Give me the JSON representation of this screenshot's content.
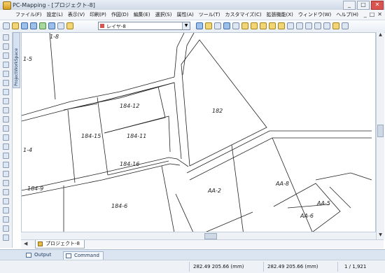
{
  "window": {
    "title": "PC-Mapping - [プロジェクト-8]",
    "minimize": "_",
    "maximize": "□",
    "close": "✕"
  },
  "menu": [
    "ファイル(F)",
    "設定(L)",
    "表示(V)",
    "印刷(P)",
    "作図(D)",
    "編集(E)",
    "選択(S)",
    "属性(A)",
    "ツール(T)",
    "カスタマイズ(C)",
    "拡張機能(X)",
    "ウィンドウ(W)",
    "ヘルプ(H)"
  ],
  "mdi_controls": [
    "_",
    "□",
    "✕"
  ],
  "toolbar": {
    "layer_combo": "レイヤ-8"
  },
  "side_panel": {
    "label": "ProjectWorkSpace"
  },
  "map": {
    "parcel_labels": [
      {
        "text": "1-4",
        "name": "label-1-4"
      },
      {
        "text": "184-12",
        "name": "label-184-12"
      },
      {
        "text": "184-15",
        "name": "label-184-15"
      },
      {
        "text": "184-11",
        "name": "label-184-11"
      },
      {
        "text": "184-16",
        "name": "label-184-16"
      },
      {
        "text": "184-6",
        "name": "label-184-6"
      },
      {
        "text": "184-9",
        "name": "label-184-9"
      },
      {
        "text": "1-8",
        "name": "label-1-8"
      },
      {
        "text": "1-5",
        "name": "label-1-5"
      },
      {
        "text": "182",
        "name": "label-182"
      },
      {
        "text": "AA-2",
        "name": "label-aa-2"
      },
      {
        "text": "AA-8",
        "name": "label-aa-8"
      },
      {
        "text": "AA-5",
        "name": "label-aa-5"
      },
      {
        "text": "AA-6",
        "name": "label-aa-6"
      }
    ]
  },
  "doc_tab": {
    "label": "プロジェクト-8"
  },
  "bottom_panel": {
    "output": "Output",
    "command": "Command"
  },
  "status": {
    "coord1": "282.49 205.66 (mm)",
    "coord2": "282.49 205.66 (mm)",
    "scale": "1 / 1,921"
  }
}
